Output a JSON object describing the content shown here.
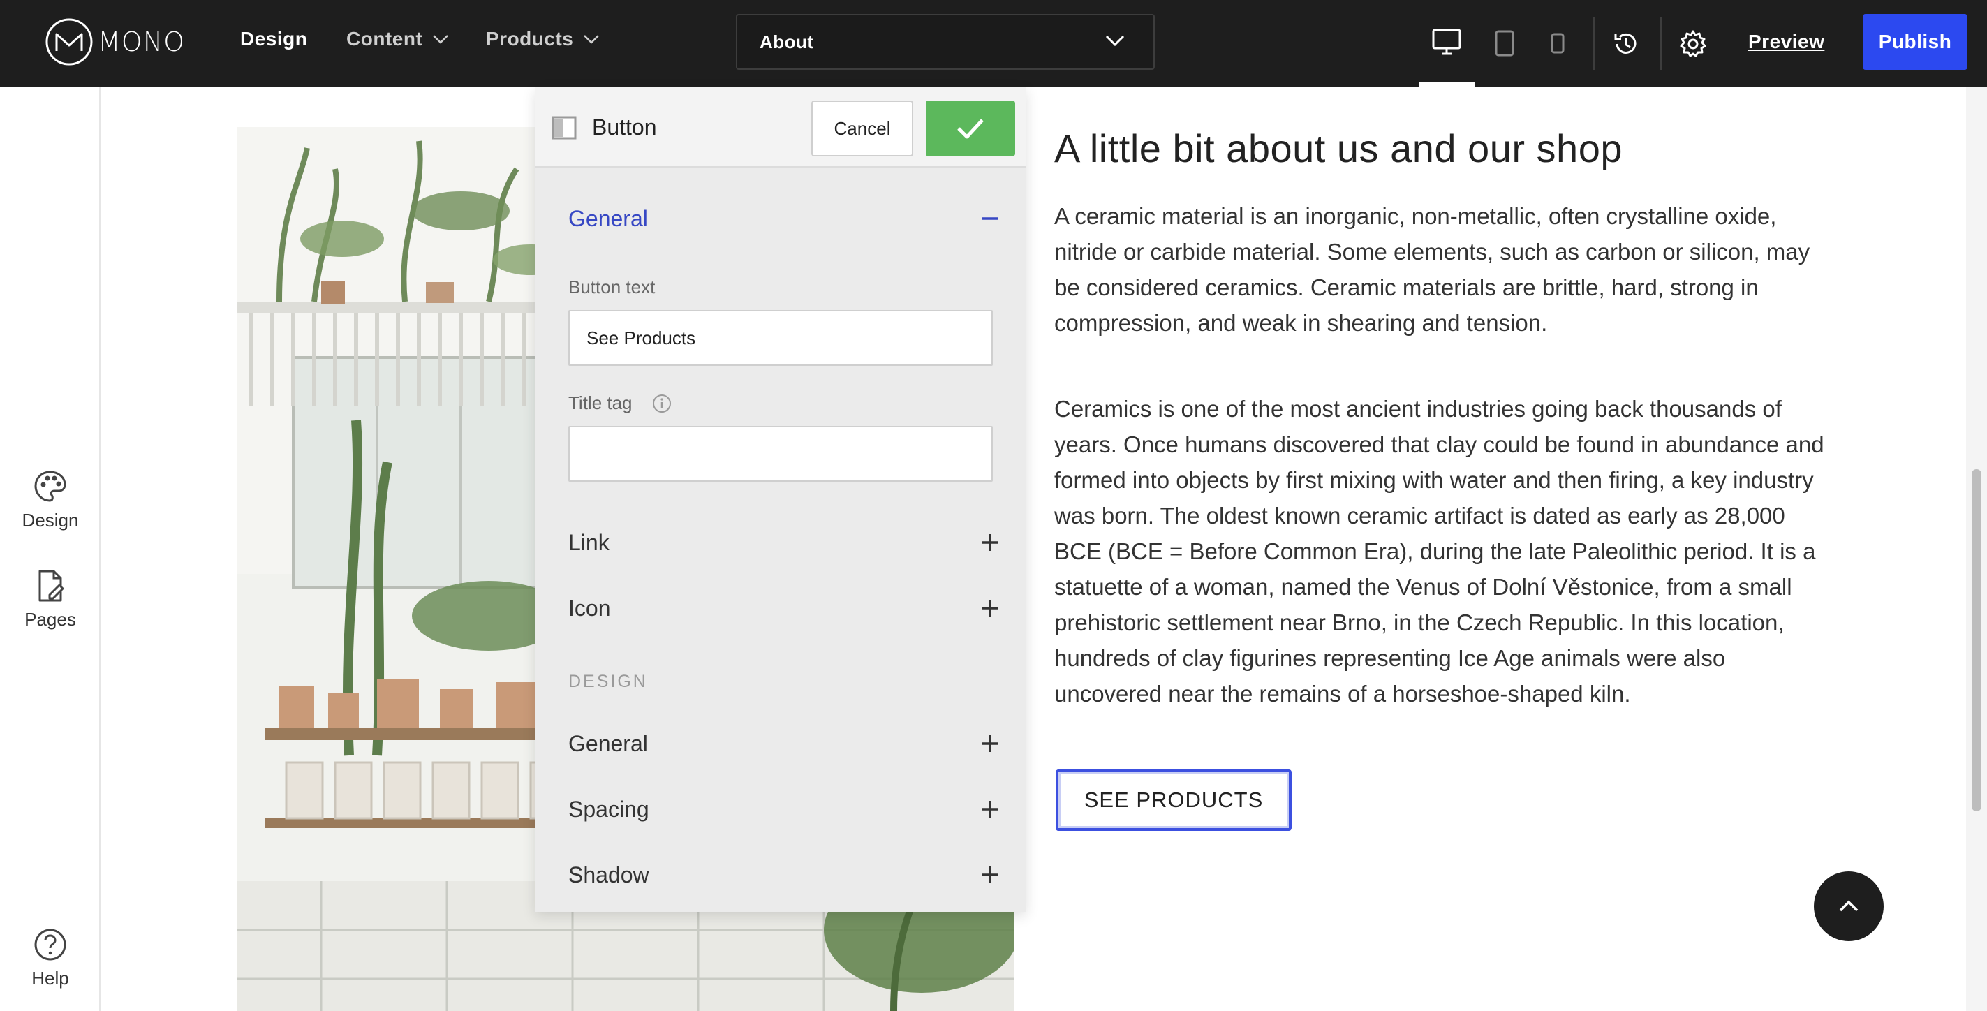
{
  "topbar": {
    "logo_text": "MONO",
    "nav": [
      {
        "label": "Design"
      },
      {
        "label": "Content"
      },
      {
        "label": "Products"
      }
    ],
    "page_selector_value": "About",
    "preview_label": "Preview",
    "publish_label": "Publish",
    "active_device": "desktop"
  },
  "sidebar": {
    "items": [
      {
        "label": "Design",
        "icon": "palette-icon"
      },
      {
        "label": "Pages",
        "icon": "pages-icon"
      },
      {
        "label": "Help",
        "icon": "help-icon"
      }
    ]
  },
  "panel": {
    "title": "Button",
    "cancel_label": "Cancel",
    "sections": {
      "general_label": "General",
      "button_text_label": "Button text",
      "button_text_value": "See Products",
      "title_tag_label": "Title tag",
      "title_tag_value": "",
      "link_label": "Link",
      "icon_label": "Icon",
      "design_heading": "DESIGN",
      "design_general_label": "General",
      "spacing_label": "Spacing",
      "shadow_label": "Shadow"
    }
  },
  "content": {
    "title": "A little bit about us and our shop",
    "paragraphs": [
      "A ceramic material is an inorganic, non-metallic, often crystalline oxide, nitride or carbide material. Some elements, such as carbon or silicon, may be considered ceramics. Ceramic materials are brittle, hard, strong in compression, and weak in shearing and tension.",
      "Ceramics is one of the most ancient industries going back thousands of years. Once humans discovered that clay could be found in abundance and formed into objects by first mixing with water and then firing, a key industry was born. The oldest known ceramic artifact is dated as early as 28,000 BCE (BCE = Before Common Era), during the late Paleolithic period. It is a statuette of a woman, named the Venus of Dolní Věstonice, from a small prehistoric settlement near Brno, in the Czech Republic. In this location, hundreds of clay figurines representing Ice Age animals were also uncovered near the remains of a horseshoe-shaped kiln."
    ],
    "button_label": "SEE PRODUCTS"
  },
  "colors": {
    "topbar_bg": "#1e1e1e",
    "publish": "#2c49f0",
    "confirm": "#5cb85c",
    "accent": "#3748c4"
  }
}
